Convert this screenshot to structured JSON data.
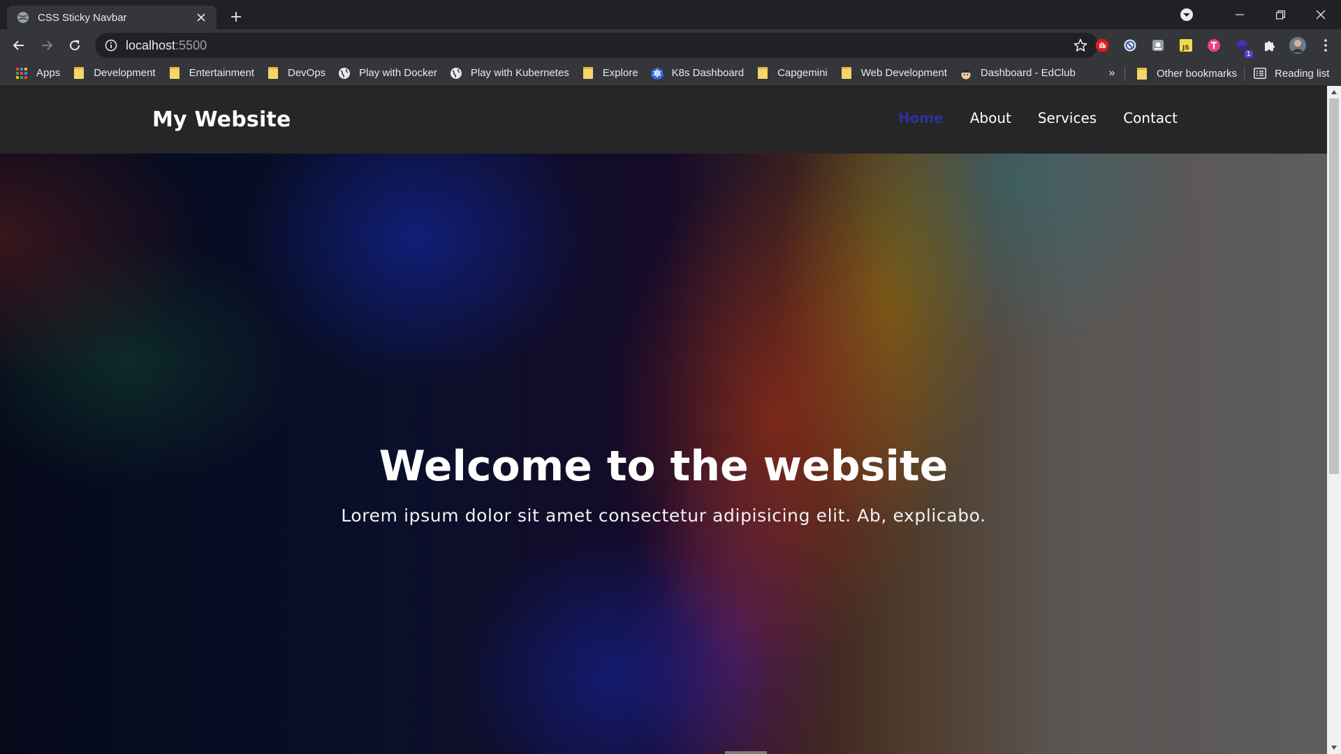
{
  "browser": {
    "tab": {
      "title": "CSS Sticky Navbar"
    },
    "address": {
      "host": "localhost",
      "port": ":5500"
    },
    "bookmarks": [
      {
        "label": "Apps",
        "icon": "apps-grid-icon"
      },
      {
        "label": "Development",
        "icon": "folder-icon"
      },
      {
        "label": "Entertainment",
        "icon": "folder-icon"
      },
      {
        "label": "DevOps",
        "icon": "folder-icon"
      },
      {
        "label": "Play with Docker",
        "icon": "globe-icon"
      },
      {
        "label": "Play with Kubernetes",
        "icon": "globe-icon"
      },
      {
        "label": "Explore",
        "icon": "folder-icon"
      },
      {
        "label": "K8s Dashboard",
        "icon": "kubernetes-icon"
      },
      {
        "label": "Capgemini",
        "icon": "folder-icon"
      },
      {
        "label": "Web Development",
        "icon": "folder-icon"
      },
      {
        "label": "Dashboard - EdClub",
        "icon": "edclub-icon"
      }
    ],
    "bookmarks_more": "»",
    "other_bookmarks": "Other bookmarks",
    "reading_list": "Reading list",
    "extension_badge": "1"
  },
  "site": {
    "logo": "My Website",
    "nav": {
      "home": "Home",
      "about": "About",
      "services": "Services",
      "contact": "Contact"
    },
    "hero": {
      "title": "Welcome to the website",
      "subtitle": "Lorem ipsum dolor sit amet consectetur adipisicing elit. Ab, explicabo."
    }
  },
  "colors": {
    "nav_active": "#2e2e9e",
    "nav_bg": "#262626",
    "browser_frame": "#35363a"
  }
}
